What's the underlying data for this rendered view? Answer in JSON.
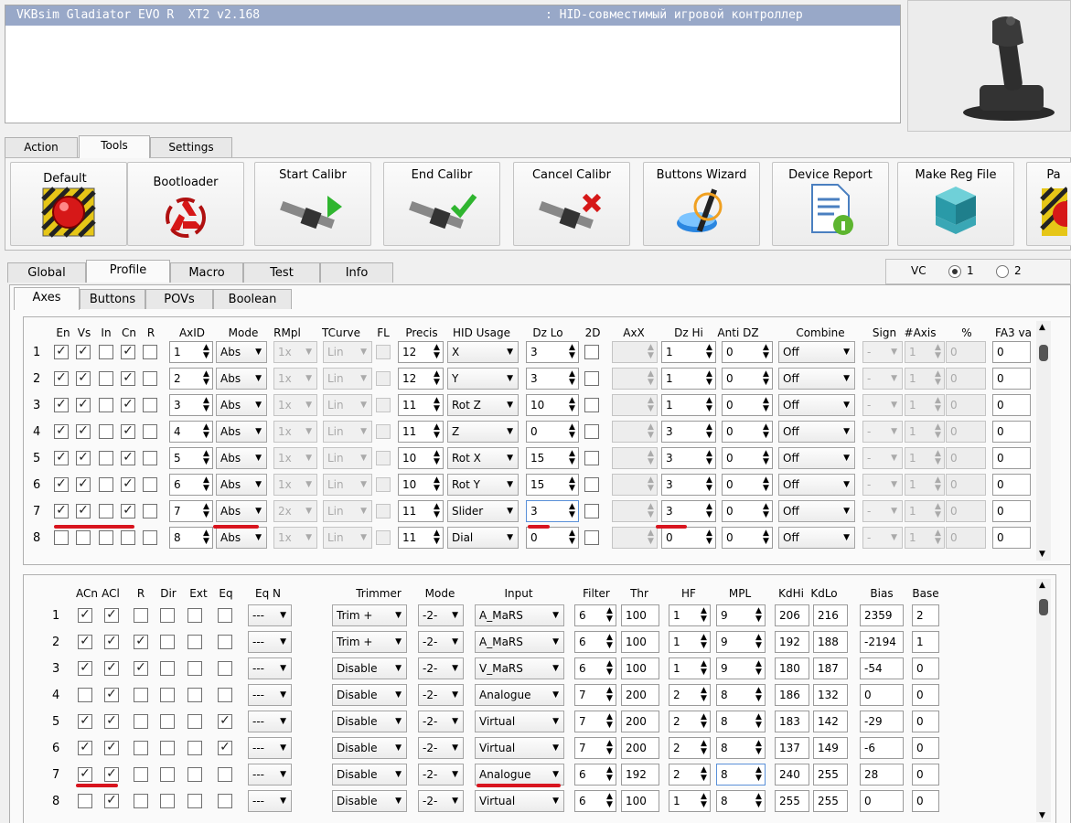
{
  "title": "VKBsim Gladiator EVO R  XT2 v2.168",
  "subtitle": ": HID-совместимый игровой контроллер",
  "main_tabs": [
    "Action",
    "Tools",
    "Settings"
  ],
  "tools": [
    "Default",
    "Bootloader",
    "Start Calibr",
    "End Calibr",
    "Cancel Calibr",
    "Buttons Wizard",
    "Device Report",
    "Make Reg File",
    "Pa"
  ],
  "profile_tabs": [
    "Global",
    "Profile",
    "Macro",
    "Test",
    "Info"
  ],
  "vc": {
    "label": "VC",
    "opt1": "1",
    "opt2": "2"
  },
  "sub_tabs": [
    "Axes",
    "Buttons",
    "POVs",
    "Boolean"
  ],
  "axes_headers": [
    "En",
    "Vs",
    "In",
    "Cn",
    "R",
    "AxID",
    "Mode",
    "RMpl",
    "TCurve",
    "FL",
    "Precis",
    "HID Usage",
    "Dz Lo",
    "2D",
    "AxX",
    "Dz Hi",
    "Anti DZ",
    "Combine",
    "Sign",
    "#Axis",
    "%",
    "FA3 va"
  ],
  "axes_rows": [
    {
      "n": "1",
      "en": true,
      "vs": true,
      "in": false,
      "cn": true,
      "r": false,
      "axid": "1",
      "mode": "Abs",
      "rmpl": "1x",
      "tc": "Lin",
      "prec": "12",
      "hid": "X",
      "dzlo": "3",
      "dzhi": "1",
      "antidz": "0",
      "comb": "Off",
      "sign": "-",
      "naxis": "1",
      "pct": "0",
      "fa3": "0"
    },
    {
      "n": "2",
      "en": true,
      "vs": true,
      "in": false,
      "cn": true,
      "r": false,
      "axid": "2",
      "mode": "Abs",
      "rmpl": "1x",
      "tc": "Lin",
      "prec": "12",
      "hid": "Y",
      "dzlo": "3",
      "dzhi": "1",
      "antidz": "0",
      "comb": "Off",
      "sign": "-",
      "naxis": "1",
      "pct": "0",
      "fa3": "0"
    },
    {
      "n": "3",
      "en": true,
      "vs": true,
      "in": false,
      "cn": true,
      "r": false,
      "axid": "3",
      "mode": "Abs",
      "rmpl": "1x",
      "tc": "Lin",
      "prec": "11",
      "hid": "Rot Z",
      "dzlo": "10",
      "dzhi": "1",
      "antidz": "0",
      "comb": "Off",
      "sign": "-",
      "naxis": "1",
      "pct": "0",
      "fa3": "0"
    },
    {
      "n": "4",
      "en": true,
      "vs": true,
      "in": false,
      "cn": true,
      "r": false,
      "axid": "4",
      "mode": "Abs",
      "rmpl": "1x",
      "tc": "Lin",
      "prec": "11",
      "hid": "Z",
      "dzlo": "0",
      "dzhi": "3",
      "antidz": "0",
      "comb": "Off",
      "sign": "-",
      "naxis": "1",
      "pct": "0",
      "fa3": "0"
    },
    {
      "n": "5",
      "en": true,
      "vs": true,
      "in": false,
      "cn": true,
      "r": false,
      "axid": "5",
      "mode": "Abs",
      "rmpl": "1x",
      "tc": "Lin",
      "prec": "10",
      "hid": "Rot X",
      "dzlo": "15",
      "dzhi": "3",
      "antidz": "0",
      "comb": "Off",
      "sign": "-",
      "naxis": "1",
      "pct": "0",
      "fa3": "0"
    },
    {
      "n": "6",
      "en": true,
      "vs": true,
      "in": false,
      "cn": true,
      "r": false,
      "axid": "6",
      "mode": "Abs",
      "rmpl": "1x",
      "tc": "Lin",
      "prec": "10",
      "hid": "Rot Y",
      "dzlo": "15",
      "dzhi": "3",
      "antidz": "0",
      "comb": "Off",
      "sign": "-",
      "naxis": "1",
      "pct": "0",
      "fa3": "0"
    },
    {
      "n": "7",
      "en": true,
      "vs": true,
      "in": false,
      "cn": true,
      "r": false,
      "axid": "7",
      "mode": "Abs",
      "rmpl": "2x",
      "tc": "Lin",
      "prec": "11",
      "hid": "Slider",
      "dzlo": "3",
      "dzhi": "3",
      "antidz": "0",
      "comb": "Off",
      "sign": "-",
      "naxis": "1",
      "pct": "0",
      "fa3": "0"
    },
    {
      "n": "8",
      "en": false,
      "vs": false,
      "in": false,
      "cn": false,
      "r": false,
      "axid": "8",
      "mode": "Abs",
      "rmpl": "1x",
      "tc": "Lin",
      "prec": "11",
      "hid": "Dial",
      "dzlo": "0",
      "dzhi": "0",
      "antidz": "0",
      "comb": "Off",
      "sign": "-",
      "naxis": "1",
      "pct": "0",
      "fa3": "0"
    }
  ],
  "btn_headers": [
    "ACn",
    "ACl",
    "R",
    "Dir",
    "Ext",
    "Eq",
    "Eq N",
    "Trimmer",
    "Mode",
    "Input",
    "Filter",
    "Thr",
    "HF",
    "MPL",
    "KdHi",
    "KdLo",
    "Bias",
    "Base"
  ],
  "btn_rows": [
    {
      "n": "1",
      "acn": true,
      "acl": true,
      "r": false,
      "dir": false,
      "ext": false,
      "eq": false,
      "eqn": "---",
      "trim": "Trim +",
      "mode": "-2-",
      "input": "A_MaRS",
      "filter": "6",
      "thr": "100",
      "hf": "1",
      "mpl": "9",
      "kdhi": "206",
      "kdlo": "216",
      "bias": "2359",
      "base": "2"
    },
    {
      "n": "2",
      "acn": true,
      "acl": true,
      "r": true,
      "dir": false,
      "ext": false,
      "eq": false,
      "eqn": "---",
      "trim": "Trim +",
      "mode": "-2-",
      "input": "A_MaRS",
      "filter": "6",
      "thr": "100",
      "hf": "1",
      "mpl": "9",
      "kdhi": "192",
      "kdlo": "188",
      "bias": "-2194",
      "base": "1"
    },
    {
      "n": "3",
      "acn": true,
      "acl": true,
      "r": true,
      "dir": false,
      "ext": false,
      "eq": false,
      "eqn": "---",
      "trim": "Disable",
      "mode": "-2-",
      "input": "V_MaRS",
      "filter": "6",
      "thr": "100",
      "hf": "1",
      "mpl": "9",
      "kdhi": "180",
      "kdlo": "187",
      "bias": "-54",
      "base": "0"
    },
    {
      "n": "4",
      "acn": false,
      "acl": true,
      "r": false,
      "dir": false,
      "ext": false,
      "eq": false,
      "eqn": "---",
      "trim": "Disable",
      "mode": "-2-",
      "input": "Analogue",
      "filter": "7",
      "thr": "200",
      "hf": "2",
      "mpl": "8",
      "kdhi": "186",
      "kdlo": "132",
      "bias": "0",
      "base": "0"
    },
    {
      "n": "5",
      "acn": true,
      "acl": true,
      "r": false,
      "dir": false,
      "ext": false,
      "eq": true,
      "eqn": "---",
      "trim": "Disable",
      "mode": "-2-",
      "input": "Virtual",
      "filter": "7",
      "thr": "200",
      "hf": "2",
      "mpl": "8",
      "kdhi": "183",
      "kdlo": "142",
      "bias": "-29",
      "base": "0"
    },
    {
      "n": "6",
      "acn": true,
      "acl": true,
      "r": false,
      "dir": false,
      "ext": false,
      "eq": true,
      "eqn": "---",
      "trim": "Disable",
      "mode": "-2-",
      "input": "Virtual",
      "filter": "7",
      "thr": "200",
      "hf": "2",
      "mpl": "8",
      "kdhi": "137",
      "kdlo": "149",
      "bias": "-6",
      "base": "0"
    },
    {
      "n": "7",
      "acn": true,
      "acl": true,
      "r": false,
      "dir": false,
      "ext": false,
      "eq": false,
      "eqn": "---",
      "trim": "Disable",
      "mode": "-2-",
      "input": "Analogue",
      "filter": "6",
      "thr": "192",
      "hf": "2",
      "mpl": "8",
      "kdhi": "240",
      "kdlo": "255",
      "bias": "28",
      "base": "0"
    },
    {
      "n": "8",
      "acn": false,
      "acl": true,
      "r": false,
      "dir": false,
      "ext": false,
      "eq": false,
      "eqn": "---",
      "trim": "Disable",
      "mode": "-2-",
      "input": "Virtual",
      "filter": "6",
      "thr": "100",
      "hf": "1",
      "mpl": "8",
      "kdhi": "255",
      "kdlo": "255",
      "bias": "0",
      "base": "0"
    }
  ]
}
